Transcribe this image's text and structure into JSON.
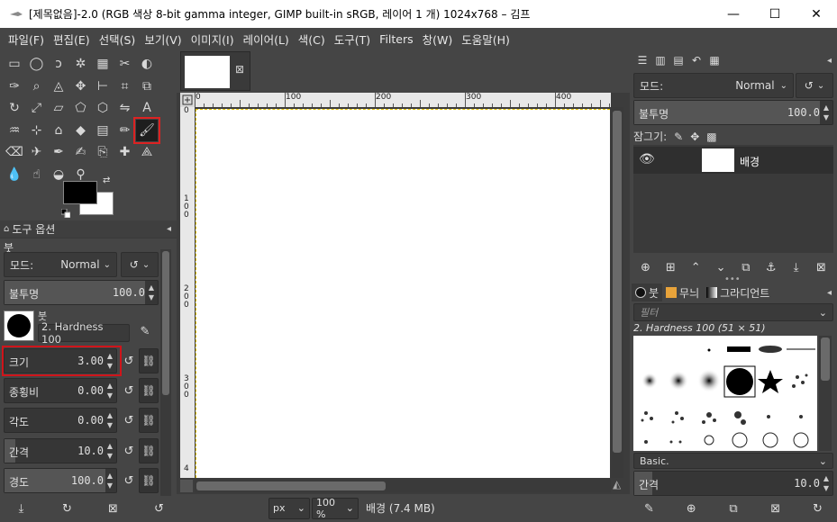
{
  "window": {
    "title": "[제목없음]-2.0 (RGB 색상 8-bit gamma integer, GIMP built-in sRGB, 레이어 1 개) 1024x768 – 김프",
    "controls": [
      "minimize",
      "maximize",
      "close"
    ]
  },
  "menubar": [
    "파일(F)",
    "편집(E)",
    "선택(S)",
    "보기(V)",
    "이미지(I)",
    "레이어(L)",
    "색(C)",
    "도구(T)",
    "Filters",
    "창(W)",
    "도움말(H)"
  ],
  "toolbox": {
    "tools": [
      "rect-select-icon",
      "ellipse-select-icon",
      "free-select-icon",
      "fuzzy-select-icon",
      "color-select-icon",
      "scissors-icon",
      "foreground-select-icon",
      "paths-icon",
      "zoom-icon",
      "measure-icon",
      "move-icon",
      "align-icon",
      "crop-icon",
      "unified-transform-icon",
      "rotate-icon",
      "scale-icon",
      "shear-icon",
      "perspective-icon",
      "transform-3d-icon",
      "flip-icon",
      "text-icon",
      "warp-icon",
      "handle-transform-icon",
      "cage-icon",
      "bucket-fill-icon",
      "gradient-icon",
      "pencil-icon",
      "paintbrush-icon",
      "eraser-icon",
      "airbrush-icon",
      "ink-icon",
      "mypaint-brush-icon",
      "clone-icon",
      "heal-icon",
      "perspective-clone-icon",
      "blur-icon",
      "smudge-icon",
      "dodge-burn-icon",
      "color-picker-icon"
    ],
    "selected_tool": "paintbrush-icon",
    "fg_color": "#000000",
    "bg_color": "#ffffff"
  },
  "tool_options": {
    "tab_label": "도구 옵션",
    "tool_name": "붓",
    "mode_label": "모드:",
    "mode_value": "Normal",
    "opacity_label": "불투명",
    "opacity_value": "100.0",
    "opacity_fraction": 1.0,
    "brush_label": "붓",
    "brush_value": "2. Hardness 100",
    "size_label": "크기",
    "size_value": "3.00",
    "aspect_label": "종횡비",
    "aspect_value": "0.00",
    "angle_label": "각도",
    "angle_value": "0.00",
    "spacing_label": "간격",
    "spacing_value": "10.0",
    "hardness_label": "경도",
    "hardness_value": "100.0"
  },
  "image_tab": {
    "close_label": "⊠"
  },
  "rulers": {
    "h_ticks": [
      "0",
      "100",
      "200",
      "300",
      "400"
    ],
    "v_ticks": [
      "0",
      "1\n0\n0",
      "2\n0\n0",
      "3\n0\n0",
      "4"
    ]
  },
  "statusbar": {
    "unit": "px",
    "zoom": "100 %",
    "info": "배경 (7.4 MB)"
  },
  "layers": {
    "mode_label": "모드:",
    "mode_value": "Normal",
    "opacity_label": "불투명",
    "opacity_value": "100.0",
    "lock_label": "잠그기:",
    "items": [
      {
        "name": "배경",
        "visible": true
      }
    ]
  },
  "brushes": {
    "tabs": [
      "붓",
      "무늬",
      "그라디언트"
    ],
    "filter_placeholder": "필터",
    "current": "2. Hardness 100 (51 × 51)",
    "tag": "Basic.",
    "spacing_label": "간격",
    "spacing_value": "10.0"
  },
  "colors": {
    "accent_red": "#d0141a",
    "panel_bg": "#454545",
    "canvas_bg": "#ffffff"
  }
}
